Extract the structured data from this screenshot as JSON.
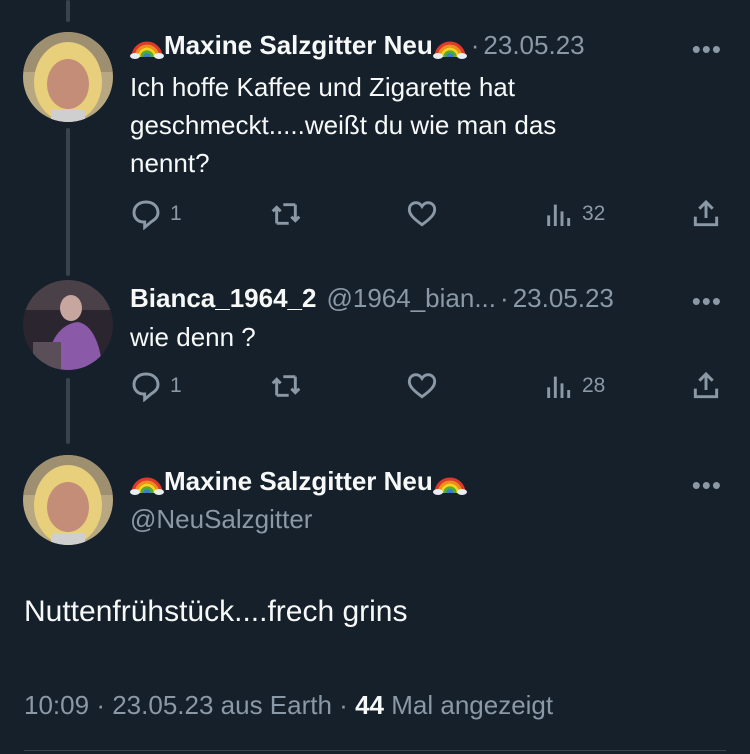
{
  "tweets": [
    {
      "name": "Maxine Salzgitter Neu",
      "date": "23.05.23",
      "dot": "·",
      "more": "•••",
      "text_lines": [
        "Ich hoffe Kaffee und Zigarette hat",
        "geschmeckt.....weißt du wie man das",
        "nennt?"
      ],
      "replies": "1",
      "views": "32"
    },
    {
      "name": "Bianca_1964_2",
      "handle": "@1964_bian...",
      "date": "23.05.23",
      "dot": "·",
      "more": "•••",
      "text": "wie denn ?",
      "replies": "1",
      "views": "28"
    }
  ],
  "main_tweet": {
    "name": "Maxine Salzgitter Neu",
    "handle": "@NeuSalzgitter",
    "more": "•••",
    "text": "Nuttenfrühstück....frech grins",
    "time": "10:09",
    "sep1": "·",
    "date": "23.05.23 aus Earth",
    "sep2": "·",
    "views_count": "44",
    "views_label": "Mal angezeigt"
  },
  "icons": [
    "reply-icon",
    "retweet-icon",
    "like-icon",
    "views-icon",
    "share-icon",
    "rainbow-icon",
    "more-icon"
  ],
  "colors": {
    "background": "#15202b",
    "text": "#f7f9f9",
    "secondary": "#8b98a5",
    "line": "#38444d"
  }
}
